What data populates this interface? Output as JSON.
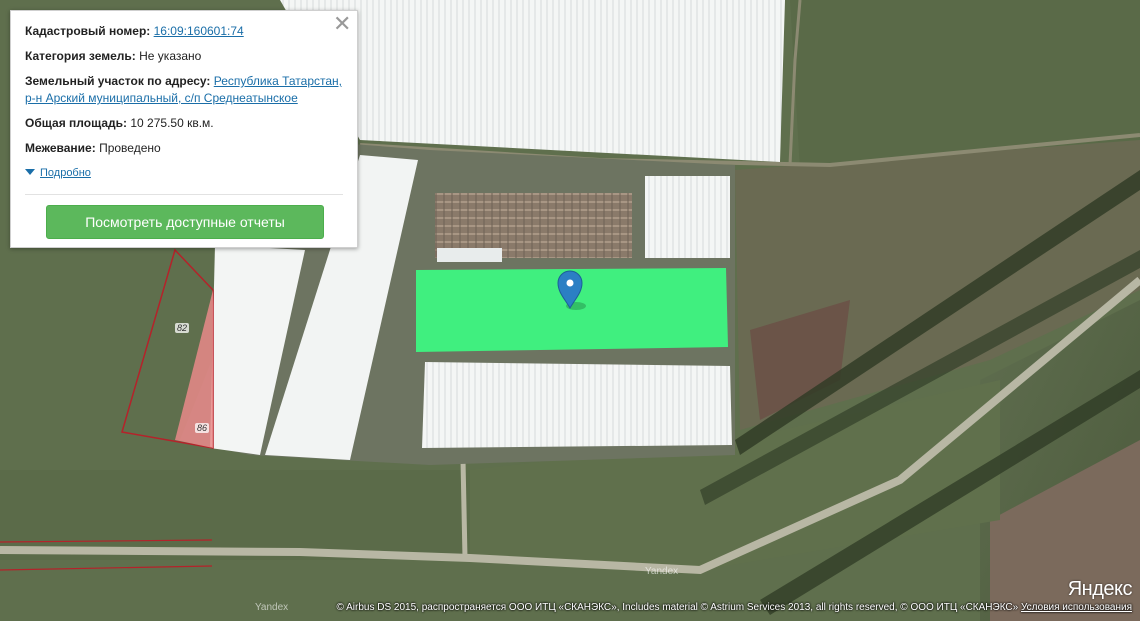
{
  "popup": {
    "cadastral_label": "Кадастровый номер:",
    "cadastral_value": "16:09:160601:74",
    "category_label": "Категория земель:",
    "category_value": "Не указано",
    "address_label": "Земельный участок по адресу:",
    "address_value_line1": "Республика Татарстан,",
    "address_value_line2": "р-н Арский муниципальный, с/п Среднеатынское",
    "area_label": "Общая площадь:",
    "area_value": "10 275.50 кв.м.",
    "survey_label": "Межевание:",
    "survey_value": "Проведено",
    "details_link": "Подробно",
    "reports_button": "Посмотреть доступные отчеты",
    "close_glyph": "✕"
  },
  "map": {
    "plot_labels": [
      "82",
      "86"
    ],
    "watermarks": [
      "Yandex",
      "Yandex"
    ],
    "highlight_color": "#3dfa82",
    "marker_color": "#2b7fc4",
    "boundary_color": "#b5222a"
  },
  "attribution": {
    "logo": "Яндекс",
    "copyright": "© Airbus DS 2015, распространяется ООО ИТЦ «СКАНЭКС», Includes material © Astrium Services 2013, all rights reserved, © ООО ИТЦ «СКАНЭКС»",
    "terms_link": "Условия использования"
  }
}
